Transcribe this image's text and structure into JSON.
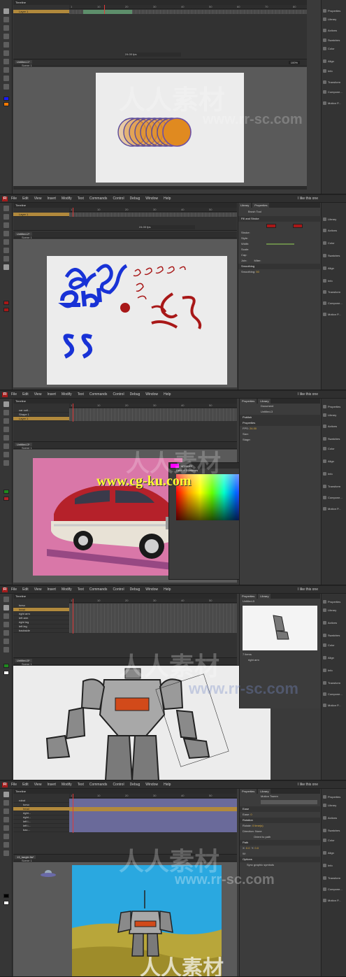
{
  "menu": [
    "File",
    "Edit",
    "View",
    "Insert",
    "Modify",
    "Text",
    "Commands",
    "Control",
    "Debug",
    "Window",
    "Help"
  ],
  "app_logo": "Fl",
  "workspace": "I like this one",
  "panel_tabs": [
    "Properties",
    "Library"
  ],
  "side_panels": [
    "Properties",
    "Library",
    "Actions",
    "Swatches",
    "Color",
    "Align",
    "Info",
    "Transform",
    "Compone...",
    "Motion P..."
  ],
  "timeline_title": "Timeline",
  "ruler": [
    "1",
    "5",
    "10",
    "15",
    "20",
    "25",
    "30",
    "35",
    "40",
    "45",
    "50",
    "55",
    "60",
    "65",
    "70",
    "75",
    "80"
  ],
  "fps": "24.00 fps",
  "frames": [
    {
      "doc_tab": "Untitled-1*",
      "scene": "Scene 1",
      "layers": [
        "Layer 1"
      ],
      "zoom": "100%",
      "accent": "#e08a20"
    },
    {
      "doc_tab": "Untitled-2*",
      "scene": "Scene 1",
      "layers": [
        "Layer 1"
      ],
      "prop_title": "Brush Tool",
      "prop_rows": [
        "Fill and Stroke",
        "Stroke:",
        "Style:",
        "Width:",
        "Scale:",
        "Cap:",
        "Join:",
        "Smoothing",
        "Smoothing:"
      ],
      "miter": "Miter:",
      "smoothing_value": "50"
    },
    {
      "doc_tab": "Untitled-3*",
      "scene": "Scene 1",
      "layers": [
        "car outl...",
        "Shape 1",
        "Layer 1"
      ],
      "prop_rows": [
        "Document",
        "Untitled-3",
        "Publish",
        "Properties",
        "FPS:",
        "Size:",
        "Stage:"
      ],
      "fps_value": "24.00",
      "swatch_hex": "#FF00FF",
      "swatch_title": "Default Swatches",
      "watermark": "www.cg-ku.com"
    },
    {
      "doc_tab": "Untitled-5*",
      "scene": "Scene 1",
      "layers": [
        "torso",
        "head",
        "right arm",
        "left arm",
        "right leg",
        "left leg",
        "backside"
      ],
      "lib_tab": "Untitled-5",
      "lib_item": "right arm",
      "lib_count": "7 items"
    },
    {
      "doc_tab": "13_tangle.fla*",
      "scene": "Scene 1",
      "layers": [
        "robot",
        "torso",
        "head",
        "right...",
        "right...",
        "left l...",
        "left l...",
        "bac..."
      ],
      "prop_rows": [
        "Motion Tween",
        "Ease",
        "Ease:",
        "Rotation",
        "Rotate:",
        "Direction:",
        "Orient to path",
        "Path",
        "X:",
        "Y:",
        "W:",
        "Options",
        "Sync graphic symbols"
      ],
      "ease_value": "0",
      "rotate_value": "0 time(s)",
      "direction_value": "None",
      "x_value": "0.0",
      "y_value": "0.0"
    }
  ],
  "watermark_cn": "人人素材",
  "watermark_url": "www.rr-sc.com",
  "colors": {
    "orange": "#e08a20",
    "blue_ink": "#1832d6",
    "red_ink": "#a81818",
    "car_red": "#b5212a",
    "sky": "#2aa8e0",
    "sand": "#b8a63a"
  }
}
